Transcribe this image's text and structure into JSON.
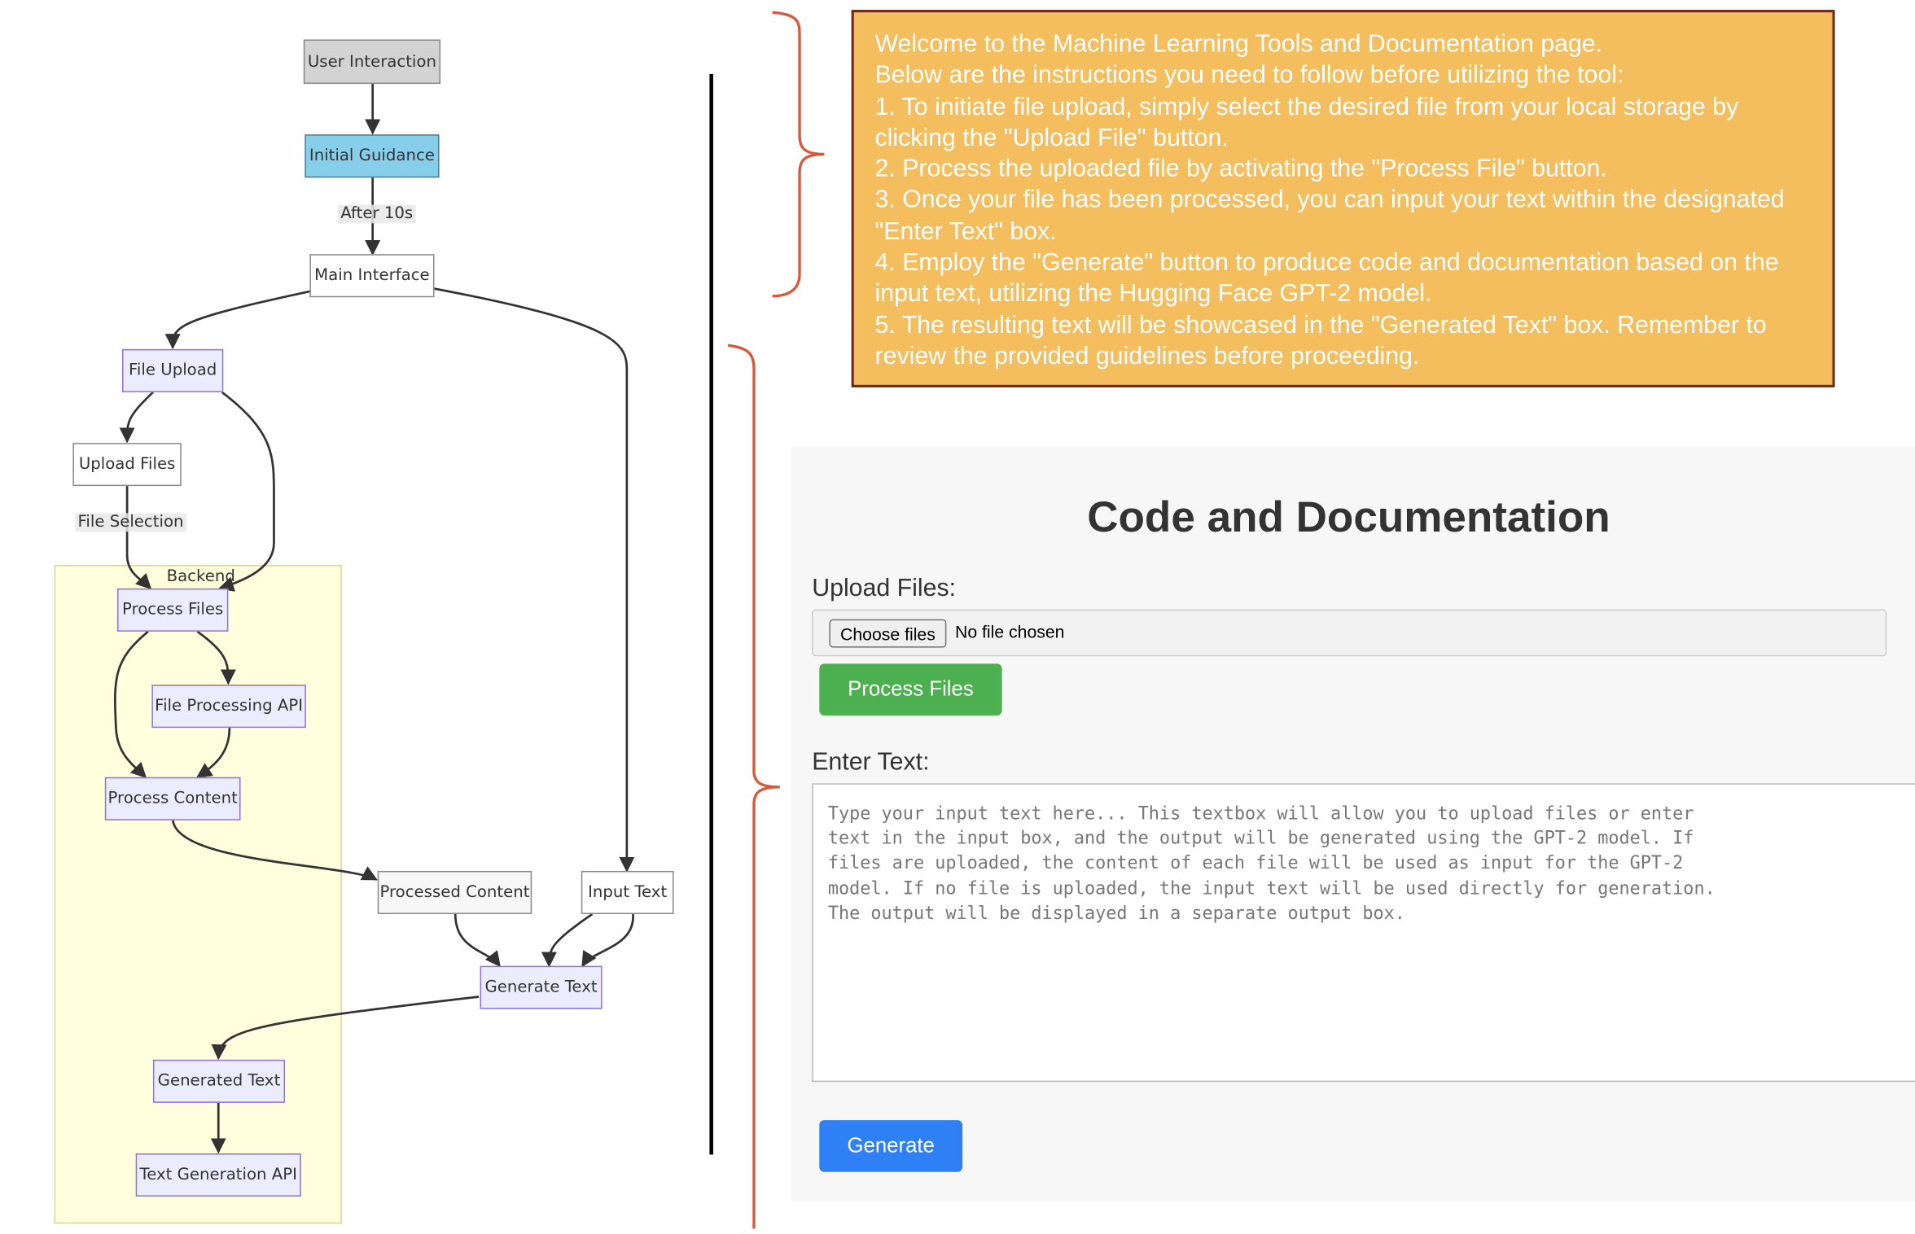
{
  "flowchart": {
    "nodes": {
      "user_interaction": "User Interaction",
      "initial_guidance": "Initial Guidance",
      "main_interface": "Main Interface",
      "file_upload": "File Upload",
      "upload_files": "Upload Files",
      "process_files": "Process Files",
      "file_processing_api": "File Processing API",
      "process_content": "Process Content",
      "processed_content": "Processed Content",
      "input_text": "Input Text",
      "generate_text": "Generate Text",
      "generated_text": "Generated Text",
      "text_generation_api": "Text Generation API"
    },
    "edge_labels": {
      "after_10s": "After 10s",
      "file_selection": "File Selection"
    },
    "cluster_label": "Backend",
    "colors": {
      "default_fill": "#ececff",
      "default_stroke": "#9370db",
      "user_interaction_fill": "#d3d3d3",
      "initial_guidance_fill": "#87ceeb",
      "cluster_fill": "#ffffde",
      "bracket": "#d9573a"
    }
  },
  "instructions": {
    "lines": [
      "Welcome to the Machine Learning Tools and Documentation page.",
      "Below are the instructions you need to follow before utilizing the tool:",
      "1. To initiate file upload, simply select the desired file from your local storage by clicking the \"Upload File\" button.",
      "2. Process the uploaded file by activating the \"Process File\" button.",
      "3. Once your file has been processed, you can input your text within the designated \"Enter Text\" box.",
      "4. Employ the \"Generate\" button to produce code and documentation based on the input text, utilizing the Hugging Face GPT-2 model.",
      "5. The resulting text will be showcased in the \"Generated Text\" box. Remember to review the provided guidelines before proceeding."
    ],
    "background": "#f4bd5d"
  },
  "app": {
    "title": "Code and Documentation",
    "upload_label": "Upload Files:",
    "choose_files": "Choose files",
    "no_file": "No file chosen",
    "process_button": "Process Files",
    "enter_text_label": "Enter Text:",
    "text_placeholder": "Type your input text here... This textbox will allow you to upload files or enter\ntext in the input box, and the output will be generated using the GPT-2 model. If\nfiles are uploaded, the content of each file will be used as input for the GPT-2\nmodel. If no file is uploaded, the input text will be used directly for generation.\nThe output will be displayed in a separate output box.",
    "generate_button": "Generate",
    "colors": {
      "process": "#4caf50",
      "generate": "#2f7ff5"
    }
  }
}
